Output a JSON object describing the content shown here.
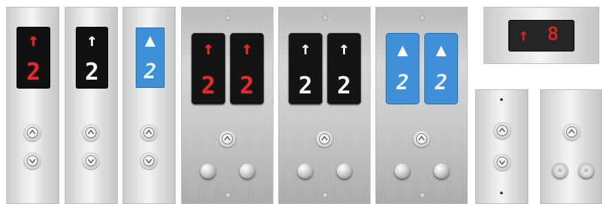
{
  "panels": [
    {
      "arrow": "↑",
      "floor": "2",
      "color": "red"
    },
    {
      "arrow": "↑",
      "floor": "2",
      "color": "white"
    },
    {
      "arrow": "▲",
      "floor": "2",
      "color": "blue"
    },
    {
      "displays": [
        {
          "arrow": "↑",
          "floor": "2"
        },
        {
          "arrow": "↑",
          "floor": "2"
        }
      ],
      "color": "red"
    },
    {
      "displays": [
        {
          "arrow": "↑",
          "floor": "2"
        },
        {
          "arrow": "↑",
          "floor": "2"
        }
      ],
      "color": "white"
    },
    {
      "displays": [
        {
          "arrow": "▲",
          "floor": "2"
        },
        {
          "arrow": "▲",
          "floor": "2"
        }
      ],
      "color": "blue"
    }
  ],
  "indicator": {
    "arrow": "↑",
    "floor": "8",
    "color": "red"
  },
  "colors": {
    "red_led": "#e8282c",
    "blue_display": "#3d8fd6",
    "black_display": "#111111"
  },
  "icons": [
    "up-arrow-icon",
    "down-arrow-icon"
  ]
}
